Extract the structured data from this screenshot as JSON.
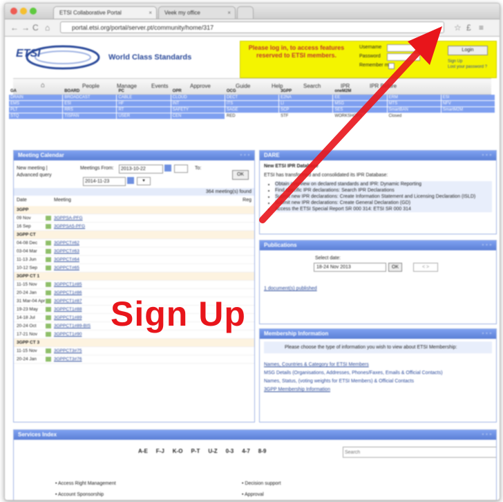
{
  "browser": {
    "tabs": [
      {
        "label": "ETSI Collaborative Portal"
      },
      {
        "label": "Veek my office"
      }
    ],
    "url": "portal.etsi.org/portal/server.pt/community/home/317"
  },
  "header": {
    "logo_text": "ETSI",
    "tagline": "World Class Standards",
    "login_message": "Please log in, to access features reserved to ETSI members.",
    "username_label": "Username",
    "password_label": "Password",
    "remember_label": "Remember me",
    "login_button": "Login",
    "signup_link": "Sign Up",
    "forgot_link": "Lost your password ?"
  },
  "menu": [
    "People",
    "Manage",
    "Events",
    "Approve",
    "Guide",
    "Help",
    "Search",
    "IPR",
    "IPR Before"
  ],
  "committee_grid": {
    "headers": [
      "GA",
      "BOARD",
      "PC",
      "OPR",
      "OCG",
      "3GPP",
      "oneM2M",
      "",
      ""
    ],
    "rows": [
      [
        "DRAIN",
        "BROADCAST",
        "CABLE",
        "CLOUD",
        "DECT",
        "E2NA",
        "EE",
        "ERM",
        "ESI"
      ],
      [
        "EMS",
        "ESI",
        "HF",
        "INT",
        "ITS",
        "LI",
        "MSG",
        "MTS",
        "NFV"
      ],
      [
        "PLT",
        "RRS",
        "RT",
        "SAFETY",
        "SAGE",
        "SCP",
        "SES",
        "SmartBAN",
        "SmartM2M"
      ],
      [
        "STQ",
        "TISPAN",
        "USER",
        "CEN",
        "RED",
        "STF",
        "WORKSHOPS",
        "Closed",
        ""
      ]
    ]
  },
  "meeting_calendar": {
    "title": "Meeting Calendar",
    "new_meeting": "New meeting |",
    "advanced_query": "Advanced query",
    "from_label": "Meetings From:",
    "from_value": "2013-10-22",
    "to_label": "To:",
    "to_value": "2014-11-23",
    "ok": "OK",
    "found": "364 meeting(s) found",
    "col_date": "Date",
    "col_meeting": "Meeting",
    "col_reg": "Reg",
    "rows": [
      {
        "group": "3GPP"
      },
      {
        "date": "09 Nov",
        "meeting": "3GPPSA-PFG"
      },
      {
        "date": "16 Sep",
        "meeting": "3GPPSA5-PFG"
      },
      {
        "group": "3GPP CT"
      },
      {
        "date": "04-08 Dec",
        "meeting": "3GPPCT#62"
      },
      {
        "date": "03-04 Mar",
        "meeting": "3GPPCT#63"
      },
      {
        "date": "11-13 Jun",
        "meeting": "3GPPCT#64"
      },
      {
        "date": "10-12 Sep",
        "meeting": "3GPPCT#65"
      },
      {
        "group": "3GPP CT 1"
      },
      {
        "date": "11-15 Nov",
        "meeting": "3GPPCT1#85"
      },
      {
        "date": "20-24 Jan",
        "meeting": "3GPPCT1#86"
      },
      {
        "date": "31 Mar-04 Apr",
        "meeting": "3GPPCT1#87"
      },
      {
        "date": "19-23 May",
        "meeting": "3GPPCT1#88"
      },
      {
        "date": "14-18 Jul",
        "meeting": "3GPPCT1#89"
      },
      {
        "date": "20-24 Oct",
        "meeting": "3GPPCT1#89-BIS"
      },
      {
        "date": "17-21 Nov",
        "meeting": "3GPPCT1#90"
      },
      {
        "group": "3GPP CT 3"
      },
      {
        "date": "11-15 Nov",
        "meeting": "3GPPCT3#75"
      },
      {
        "date": "20-24 Jan",
        "meeting": "3GPPCT3#76"
      }
    ]
  },
  "dare": {
    "title": "DARE",
    "heading": "New ETSI IPR Database",
    "intro": "ETSI has transformed and consolidated its IPR Database:",
    "items": [
      "Obtain overview on declared standards and IPR: Dynamic Reporting",
      "Find specific IPR declarations: Search IPR Declarations",
      "Submit new IPR declarations: Create Information Statement and Licensing Declaration (ISLD)",
      "Submit new IPR declarations: Create General Declaration (GD)",
      "Access the ETSI Special Report SR 000 314: ETSI SR 000 314"
    ]
  },
  "publications": {
    "title": "Publications",
    "select_label": "Select date:",
    "select_value": "18-24 Nov 2013",
    "ok": "OK",
    "nav": "< >",
    "result": "1 document(s) published"
  },
  "membership": {
    "title": "Membership Information",
    "intro": "Please choose the type of information you wish to view about ETSI Membership:",
    "links": [
      "Names, Countries & Category for ETSI Members",
      "MSG Details (Organisations, Addresses, Phones/Faxes, Emails & Official Contacts)",
      "Names, Status, (voting weights for ETSI Members) & Official Contacts",
      "3GPP Membership Information"
    ]
  },
  "services": {
    "title": "Services Index",
    "letters": [
      "A-E",
      "F-J",
      "K-O",
      "P-T",
      "U-Z",
      "0-3",
      "4-7",
      "8-9"
    ],
    "search_placeholder": "Search",
    "items_left": [
      "Access Right Management",
      "Account Sponsorship"
    ],
    "items_right": [
      "Decision support",
      "Approval"
    ]
  },
  "overlay": {
    "label": "Sign Up",
    "color": "#e8151b"
  }
}
